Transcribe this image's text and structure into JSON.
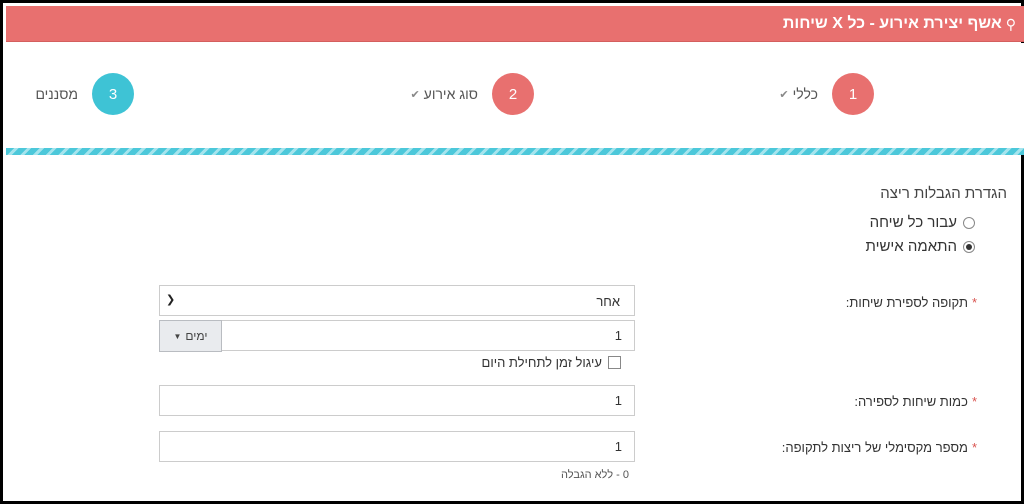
{
  "header": {
    "title": "אשף יצירת אירוע - כל X שיחות",
    "icon": "magic-wand-icon"
  },
  "steps": [
    {
      "number": "1",
      "label": "כללי",
      "done": true,
      "color": "#e8706f"
    },
    {
      "number": "2",
      "label": "סוג אירוע",
      "done": true,
      "color": "#e8706f"
    },
    {
      "number": "3",
      "label": "מסננים",
      "done": false,
      "color": "#3ec3d5"
    }
  ],
  "limits": {
    "section_title": "הגדרת הגבלות ריצה",
    "options": [
      {
        "label": "עבור כל שיחה",
        "selected": false
      },
      {
        "label": "התאמה אישית",
        "selected": true
      }
    ]
  },
  "fields": {
    "period": {
      "required_mark": "*",
      "label": "תקופה לספירת שיחות:",
      "select_value": "אחר",
      "amount_value": "1",
      "unit_label": "ימים"
    },
    "round_time": {
      "label": "עיגול זמן לתחילת היום",
      "checked": false
    },
    "calls_count": {
      "required_mark": "*",
      "label": "כמות שיחות לספירה:",
      "value": "1"
    },
    "max_runs": {
      "required_mark": "*",
      "label": "מספר מקסימלי של ריצות לתקופה:",
      "value": "1",
      "hint": "0 - ללא הגבלה"
    }
  }
}
